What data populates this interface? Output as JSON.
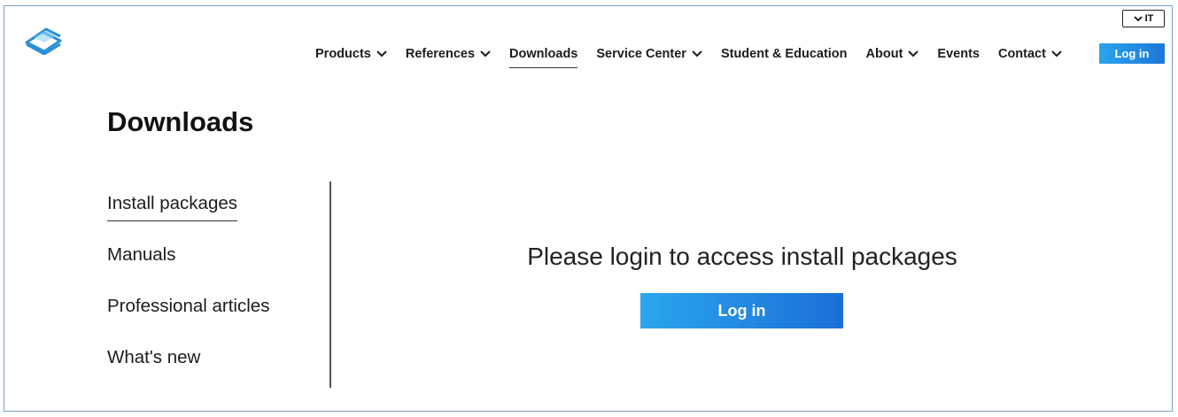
{
  "header": {
    "logo_icon": "layered-sheets-logo",
    "language": {
      "label": "IT",
      "icon": "chevron-down-icon"
    },
    "nav": [
      {
        "label": "Products",
        "has_dropdown": true
      },
      {
        "label": "References",
        "has_dropdown": true
      },
      {
        "label": "Downloads",
        "has_dropdown": false,
        "active": true
      },
      {
        "label": "Service Center",
        "has_dropdown": true
      },
      {
        "label": "Student & Education",
        "has_dropdown": false
      },
      {
        "label": "About",
        "has_dropdown": true
      },
      {
        "label": "Events",
        "has_dropdown": false
      },
      {
        "label": "Contact",
        "has_dropdown": true
      }
    ],
    "login_label": "Log in"
  },
  "main": {
    "title": "Downloads",
    "sidebar": [
      {
        "label": "Install packages",
        "active": true
      },
      {
        "label": "Manuals"
      },
      {
        "label": "Professional articles"
      },
      {
        "label": "What's new"
      }
    ],
    "prompt": "Please login to access install packages",
    "login_label": "Log in"
  },
  "colors": {
    "accent": "#1b78d8",
    "accent_light": "#2aa4ec",
    "text": "#1c1c1c"
  }
}
